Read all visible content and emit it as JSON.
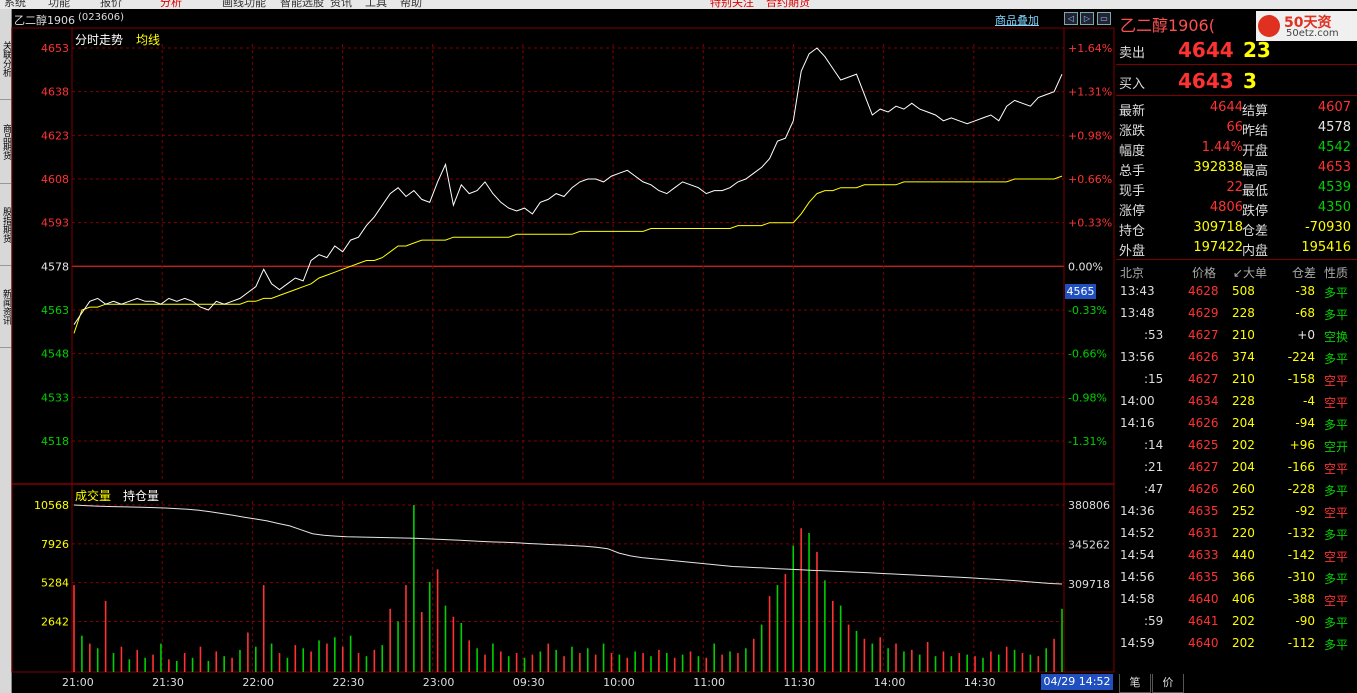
{
  "menu": [
    "系统",
    "功能",
    "报价",
    "分析",
    "画线功能",
    "智能选股",
    "资讯",
    "工具",
    "帮助",
    "特别关注",
    "合约期货"
  ],
  "side_tabs": [
    "关联分析",
    "商品期货",
    "股指期货",
    "新闻资讯"
  ],
  "header": {
    "contract": "乙二醇1906",
    "code": "(023606)",
    "overlay_button": "商品叠加",
    "panel_tab_time": "分时走势",
    "panel_tab_avg": "均线",
    "vol_tab": "成交量",
    "oi_tab": "持仓量"
  },
  "chart_data": {
    "type": "line",
    "prev_settle": 4578,
    "price_axis": [
      "4653",
      "4638",
      "4623",
      "4608",
      "4593",
      "4578",
      "4563",
      "4548",
      "4533",
      "4518"
    ],
    "pct_axis": [
      "+1.64%",
      "+1.31%",
      "+0.98%",
      "+0.66%",
      "+0.33%",
      "0.00%",
      "-0.33%",
      "-0.66%",
      "-0.98%",
      "-1.31%"
    ],
    "volume_axis": [
      "10568",
      "7926",
      "5284",
      "2642"
    ],
    "oi_axis": [
      "380806",
      "345262",
      "309718"
    ],
    "time_labels": [
      "21:00",
      "21:30",
      "22:00",
      "22:30",
      "23:00",
      "09:30",
      "10:00",
      "11:00",
      "11:30",
      "14:00",
      "14:30"
    ],
    "price_series": [
      4558,
      4562,
      4566,
      4567,
      4565,
      4566,
      4565,
      4566,
      4567,
      4566,
      4566,
      4565,
      4567,
      4566,
      4567,
      4566,
      4564,
      4563,
      4566,
      4565,
      4566,
      4567,
      4569,
      4571,
      4577,
      4572,
      4570,
      4572,
      4574,
      4573,
      4580,
      4582,
      4581,
      4585,
      4583,
      4587,
      4588,
      4592,
      4595,
      4599,
      4603,
      4605,
      4602,
      4604,
      4601,
      4600,
      4607,
      4613,
      4599,
      4606,
      4603,
      4604,
      4607,
      4603,
      4600,
      4598,
      4597,
      4598,
      4596,
      4600,
      4601,
      4603,
      4602,
      4605,
      4607,
      4608,
      4608,
      4607,
      4609,
      4610,
      4611,
      4609,
      4607,
      4606,
      4604,
      4603,
      4605,
      4607,
      4606,
      4605,
      4603,
      4604,
      4604,
      4605,
      4607,
      4608,
      4610,
      4612,
      4615,
      4621,
      4622,
      4628,
      4645,
      4651,
      4653,
      4650,
      4646,
      4642,
      4643,
      4644,
      4637,
      4630,
      4632,
      4631,
      4633,
      4632,
      4634,
      4632,
      4631,
      4630,
      4628,
      4629,
      4628,
      4627,
      4628,
      4629,
      4630,
      4628,
      4633,
      4635,
      4634,
      4633,
      4636,
      4637,
      4638,
      4644
    ],
    "avg_series": [
      4555,
      4563,
      4564,
      4564,
      4565,
      4565,
      4565,
      4565,
      4565,
      4565,
      4565,
      4565,
      4565,
      4565,
      4565,
      4565,
      4565,
      4565,
      4565,
      4565,
      4565,
      4565,
      4566,
      4566,
      4567,
      4567,
      4568,
      4569,
      4570,
      4571,
      4572,
      4574,
      4575,
      4576,
      4577,
      4578,
      4579,
      4580,
      4580,
      4581,
      4583,
      4585,
      4585,
      4586,
      4587,
      4587,
      4587,
      4587,
      4588,
      4588,
      4588,
      4588,
      4588,
      4588,
      4588,
      4588,
      4589,
      4589,
      4589,
      4589,
      4589,
      4589,
      4589,
      4589,
      4590,
      4590,
      4590,
      4590,
      4590,
      4590,
      4590,
      4590,
      4590,
      4591,
      4591,
      4591,
      4591,
      4591,
      4591,
      4591,
      4591,
      4591,
      4591,
      4591,
      4592,
      4592,
      4592,
      4592,
      4593,
      4593,
      4593,
      4593,
      4596,
      4600,
      4603,
      4604,
      4604,
      4605,
      4605,
      4605,
      4606,
      4606,
      4606,
      4606,
      4606,
      4607,
      4607,
      4607,
      4607,
      4607,
      4607,
      4607,
      4607,
      4607,
      4607,
      4607,
      4607,
      4607,
      4607,
      4608,
      4608,
      4608,
      4608,
      4608,
      4608,
      4609
    ],
    "volume_series": [
      5500,
      2300,
      1800,
      1500,
      4500,
      1200,
      1600,
      800,
      1400,
      900,
      1100,
      1800,
      800,
      700,
      1200,
      900,
      1600,
      700,
      1300,
      1000,
      900,
      1400,
      2500,
      1600,
      5500,
      1800,
      1200,
      900,
      1700,
      1500,
      1300,
      2000,
      1800,
      2200,
      1600,
      2300,
      1200,
      1000,
      1400,
      1700,
      4000,
      3200,
      5500,
      10568,
      3800,
      5700,
      6500,
      4200,
      3500,
      3100,
      2000,
      1500,
      1100,
      1800,
      1300,
      1000,
      1200,
      900,
      1100,
      1300,
      1800,
      1400,
      1000,
      1600,
      1200,
      1500,
      1100,
      1800,
      1200,
      1100,
      900,
      1300,
      1200,
      1000,
      1400,
      1200,
      900,
      1100,
      1300,
      1000,
      900,
      1800,
      1100,
      1300,
      1200,
      1500,
      2100,
      3000,
      4800,
      5500,
      6200,
      8000,
      9100,
      8800,
      7600,
      5800,
      4500,
      4200,
      3000,
      2600,
      2100,
      1800,
      2200,
      1500,
      1800,
      1300,
      1400,
      1100,
      1900,
      1000,
      1300,
      1000,
      1200,
      1100,
      1000,
      900,
      1300,
      1100,
      1600,
      1400,
      1200,
      1100,
      1000,
      1500,
      2100,
      4000
    ],
    "oi_series": [
      380806,
      380300,
      379800,
      379500,
      379300,
      379000,
      378800,
      378500,
      378100,
      377600,
      377000,
      376000,
      374800,
      373200,
      371500,
      369800,
      368200,
      366500,
      364200,
      362000,
      358500,
      355000,
      353500,
      352800,
      352300,
      352000,
      351800,
      351600,
      351400,
      351100,
      350800,
      350400,
      350000,
      349500,
      349000,
      348500,
      348000,
      347500,
      347200,
      346800,
      346200,
      345700,
      345200,
      344800,
      344300,
      343600,
      342800,
      341500,
      337500,
      335000,
      333500,
      332500,
      331500,
      330500,
      329500,
      328500,
      327500,
      326500,
      325500,
      325000,
      324500,
      324000,
      323500,
      323000,
      322500,
      322000,
      321600,
      321200,
      320800,
      320300,
      319800,
      319300,
      318800,
      318300,
      317800,
      317300,
      316800,
      316300,
      315800,
      315200,
      314600,
      314000,
      313300,
      312600,
      311800,
      311000,
      310200,
      309718
    ]
  },
  "price_marker": "4565",
  "date_marker": "04/29 14:52",
  "quote": {
    "title": "乙二醇1906(",
    "logo_main": "50天资",
    "logo_sub": "50etz.com",
    "sell_label": "卖出",
    "sell_price": "4644",
    "sell_vol": "23",
    "buy_label": "买入",
    "buy_price": "4643",
    "buy_vol": "3",
    "rows": [
      {
        "l1": "最新",
        "v1": "4644",
        "l2": "结算",
        "v2": "4607"
      },
      {
        "l1": "涨跌",
        "v1": "66",
        "l2": "昨结",
        "v2": "4578"
      },
      {
        "l1": "幅度",
        "v1": "1.44%",
        "l2": "开盘",
        "v2": "4542"
      },
      {
        "l1": "总手",
        "v1": "392838",
        "l2": "最高",
        "v2": "4653"
      },
      {
        "l1": "现手",
        "v1": "22",
        "l2": "最低",
        "v2": "4539"
      },
      {
        "l1": "涨停",
        "v1": "4806",
        "l2": "跌停",
        "v2": "4350"
      },
      {
        "l1": "持仓",
        "v1": "309718",
        "l2": "仓差",
        "v2": "-70930"
      },
      {
        "l1": "外盘",
        "v1": "197422",
        "l2": "内盘",
        "v2": "195416"
      }
    ]
  },
  "trades_header": {
    "time": "北京",
    "price": "价格",
    "vol": "↙大单",
    "diff": "仓差",
    "type": "性质"
  },
  "trades": [
    {
      "t": "13:43",
      "p": "4628",
      "v": "508",
      "d": "-38",
      "k": "多平"
    },
    {
      "t": "13:48",
      "p": "4629",
      "v": "228",
      "d": "-68",
      "k": "多平"
    },
    {
      "t": ":53",
      "p": "4627",
      "v": "210",
      "d": "+0",
      "k": "空换"
    },
    {
      "t": "13:56",
      "p": "4626",
      "v": "374",
      "d": "-224",
      "k": "多平"
    },
    {
      "t": ":15",
      "p": "4627",
      "v": "210",
      "d": "-158",
      "k": "空平"
    },
    {
      "t": "14:00",
      "p": "4634",
      "v": "228",
      "d": "-4",
      "k": "空平"
    },
    {
      "t": "14:16",
      "p": "4626",
      "v": "204",
      "d": "-94",
      "k": "多平"
    },
    {
      "t": ":14",
      "p": "4625",
      "v": "202",
      "d": "+96",
      "k": "空开"
    },
    {
      "t": ":21",
      "p": "4627",
      "v": "204",
      "d": "-166",
      "k": "空平"
    },
    {
      "t": ":47",
      "p": "4626",
      "v": "260",
      "d": "-228",
      "k": "多平"
    },
    {
      "t": "14:36",
      "p": "4635",
      "v": "252",
      "d": "-92",
      "k": "空平"
    },
    {
      "t": "14:52",
      "p": "4631",
      "v": "220",
      "d": "-132",
      "k": "多平"
    },
    {
      "t": "14:54",
      "p": "4633",
      "v": "440",
      "d": "-142",
      "k": "空平"
    },
    {
      "t": "14:56",
      "p": "4635",
      "v": "366",
      "d": "-310",
      "k": "多平"
    },
    {
      "t": "14:58",
      "p": "4640",
      "v": "406",
      "d": "-388",
      "k": "空平"
    },
    {
      "t": ":59",
      "p": "4641",
      "v": "202",
      "d": "-90",
      "k": "多平"
    },
    {
      "t": "14:59",
      "p": "4640",
      "v": "202",
      "d": "-112",
      "k": "多平"
    }
  ],
  "bottom_tabs": [
    "笔",
    "价"
  ],
  "colors": {
    "up": "#ff3232",
    "down": "#00d000",
    "white": "#e6e6e6",
    "yellow": "#ffff00",
    "grid": "#800000",
    "cyan": "#7fd8ff"
  }
}
